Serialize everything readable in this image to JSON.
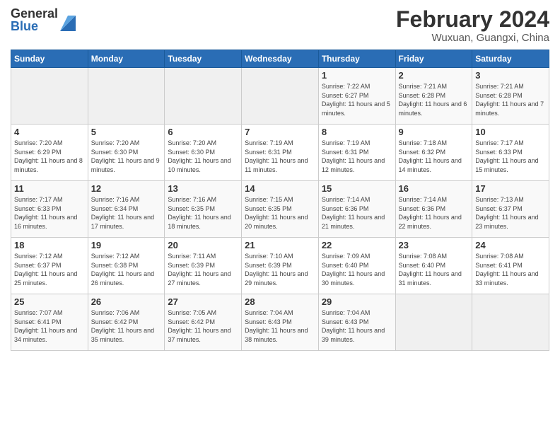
{
  "logo": {
    "general": "General",
    "blue": "Blue"
  },
  "title": "February 2024",
  "location": "Wuxuan, Guangxi, China",
  "days_of_week": [
    "Sunday",
    "Monday",
    "Tuesday",
    "Wednesday",
    "Thursday",
    "Friday",
    "Saturday"
  ],
  "weeks": [
    [
      {
        "day": "",
        "info": ""
      },
      {
        "day": "",
        "info": ""
      },
      {
        "day": "",
        "info": ""
      },
      {
        "day": "",
        "info": ""
      },
      {
        "day": "1",
        "info": "Sunrise: 7:22 AM\nSunset: 6:27 PM\nDaylight: 11 hours and 5 minutes."
      },
      {
        "day": "2",
        "info": "Sunrise: 7:21 AM\nSunset: 6:28 PM\nDaylight: 11 hours and 6 minutes."
      },
      {
        "day": "3",
        "info": "Sunrise: 7:21 AM\nSunset: 6:28 PM\nDaylight: 11 hours and 7 minutes."
      }
    ],
    [
      {
        "day": "4",
        "info": "Sunrise: 7:20 AM\nSunset: 6:29 PM\nDaylight: 11 hours and 8 minutes."
      },
      {
        "day": "5",
        "info": "Sunrise: 7:20 AM\nSunset: 6:30 PM\nDaylight: 11 hours and 9 minutes."
      },
      {
        "day": "6",
        "info": "Sunrise: 7:20 AM\nSunset: 6:30 PM\nDaylight: 11 hours and 10 minutes."
      },
      {
        "day": "7",
        "info": "Sunrise: 7:19 AM\nSunset: 6:31 PM\nDaylight: 11 hours and 11 minutes."
      },
      {
        "day": "8",
        "info": "Sunrise: 7:19 AM\nSunset: 6:31 PM\nDaylight: 11 hours and 12 minutes."
      },
      {
        "day": "9",
        "info": "Sunrise: 7:18 AM\nSunset: 6:32 PM\nDaylight: 11 hours and 14 minutes."
      },
      {
        "day": "10",
        "info": "Sunrise: 7:17 AM\nSunset: 6:33 PM\nDaylight: 11 hours and 15 minutes."
      }
    ],
    [
      {
        "day": "11",
        "info": "Sunrise: 7:17 AM\nSunset: 6:33 PM\nDaylight: 11 hours and 16 minutes."
      },
      {
        "day": "12",
        "info": "Sunrise: 7:16 AM\nSunset: 6:34 PM\nDaylight: 11 hours and 17 minutes."
      },
      {
        "day": "13",
        "info": "Sunrise: 7:16 AM\nSunset: 6:35 PM\nDaylight: 11 hours and 18 minutes."
      },
      {
        "day": "14",
        "info": "Sunrise: 7:15 AM\nSunset: 6:35 PM\nDaylight: 11 hours and 20 minutes."
      },
      {
        "day": "15",
        "info": "Sunrise: 7:14 AM\nSunset: 6:36 PM\nDaylight: 11 hours and 21 minutes."
      },
      {
        "day": "16",
        "info": "Sunrise: 7:14 AM\nSunset: 6:36 PM\nDaylight: 11 hours and 22 minutes."
      },
      {
        "day": "17",
        "info": "Sunrise: 7:13 AM\nSunset: 6:37 PM\nDaylight: 11 hours and 23 minutes."
      }
    ],
    [
      {
        "day": "18",
        "info": "Sunrise: 7:12 AM\nSunset: 6:37 PM\nDaylight: 11 hours and 25 minutes."
      },
      {
        "day": "19",
        "info": "Sunrise: 7:12 AM\nSunset: 6:38 PM\nDaylight: 11 hours and 26 minutes."
      },
      {
        "day": "20",
        "info": "Sunrise: 7:11 AM\nSunset: 6:39 PM\nDaylight: 11 hours and 27 minutes."
      },
      {
        "day": "21",
        "info": "Sunrise: 7:10 AM\nSunset: 6:39 PM\nDaylight: 11 hours and 29 minutes."
      },
      {
        "day": "22",
        "info": "Sunrise: 7:09 AM\nSunset: 6:40 PM\nDaylight: 11 hours and 30 minutes."
      },
      {
        "day": "23",
        "info": "Sunrise: 7:08 AM\nSunset: 6:40 PM\nDaylight: 11 hours and 31 minutes."
      },
      {
        "day": "24",
        "info": "Sunrise: 7:08 AM\nSunset: 6:41 PM\nDaylight: 11 hours and 33 minutes."
      }
    ],
    [
      {
        "day": "25",
        "info": "Sunrise: 7:07 AM\nSunset: 6:41 PM\nDaylight: 11 hours and 34 minutes."
      },
      {
        "day": "26",
        "info": "Sunrise: 7:06 AM\nSunset: 6:42 PM\nDaylight: 11 hours and 35 minutes."
      },
      {
        "day": "27",
        "info": "Sunrise: 7:05 AM\nSunset: 6:42 PM\nDaylight: 11 hours and 37 minutes."
      },
      {
        "day": "28",
        "info": "Sunrise: 7:04 AM\nSunset: 6:43 PM\nDaylight: 11 hours and 38 minutes."
      },
      {
        "day": "29",
        "info": "Sunrise: 7:04 AM\nSunset: 6:43 PM\nDaylight: 11 hours and 39 minutes."
      },
      {
        "day": "",
        "info": ""
      },
      {
        "day": "",
        "info": ""
      }
    ]
  ]
}
